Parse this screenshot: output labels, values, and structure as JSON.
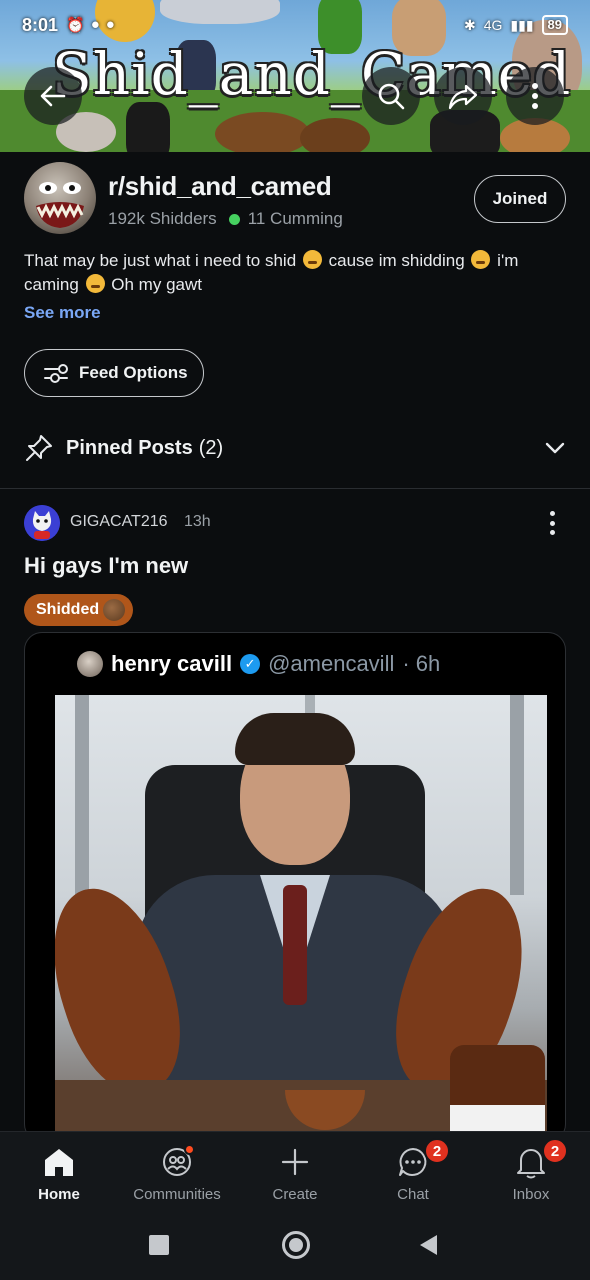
{
  "status_bar": {
    "time": "8:01",
    "network": "4G",
    "battery": "89"
  },
  "banner": {
    "title": "Shid_and_Camed"
  },
  "subreddit": {
    "name": "r/shid_and_camed",
    "members": "192k Shidders",
    "online": "11 Cumming",
    "joined_label": "Joined",
    "description_parts": [
      "That may be just what i need to shid",
      "cause im shidding",
      "i'm caming",
      "Oh my gawt"
    ],
    "see_more": "See more",
    "feed_options": "Feed Options",
    "pinned_label": "Pinned Posts",
    "pinned_count": "(2)"
  },
  "post": {
    "author": "GIGACAT216",
    "time": "13h",
    "title": "Hi gays I'm new",
    "flair": "Shidded",
    "tweet": {
      "name": "henry cavill",
      "handle": "@amencavill",
      "age": "· 6h"
    }
  },
  "bottom_nav": {
    "items": [
      {
        "label": "Home",
        "icon": "home-icon"
      },
      {
        "label": "Communities",
        "icon": "communities-icon"
      },
      {
        "label": "Create",
        "icon": "plus-icon"
      },
      {
        "label": "Chat",
        "icon": "chat-icon",
        "badge": "2"
      },
      {
        "label": "Inbox",
        "icon": "bell-icon",
        "badge": "2"
      }
    ]
  },
  "colors": {
    "background": "#0b0d0f",
    "accent_link": "#7aa7f5",
    "online": "#46d160",
    "flair": "#b0561a",
    "badge": "#e0311f"
  }
}
